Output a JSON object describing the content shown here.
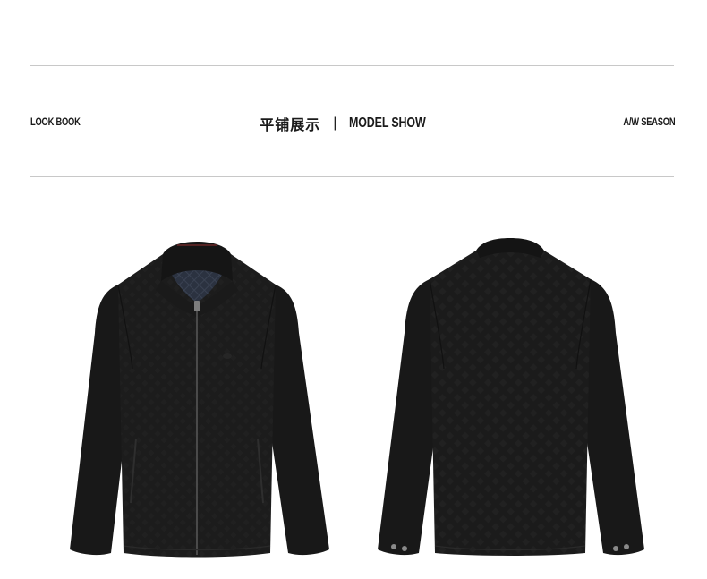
{
  "header": {
    "left_label": "LOOK BOOK",
    "center_cn": "平铺展示",
    "center_separator": "|",
    "center_en": "MODEL SHOW",
    "right_label": "A/W SEASON"
  },
  "products": {
    "front": {
      "view": "front",
      "color": "#1c1c1c"
    },
    "back": {
      "view": "back",
      "color": "#1c1c1c"
    }
  },
  "colors": {
    "background": "#ffffff",
    "rule": "#c8c8c8",
    "jacket": "#1c1c1c",
    "lining": "#2b3240",
    "text": "#1a1a1a"
  }
}
